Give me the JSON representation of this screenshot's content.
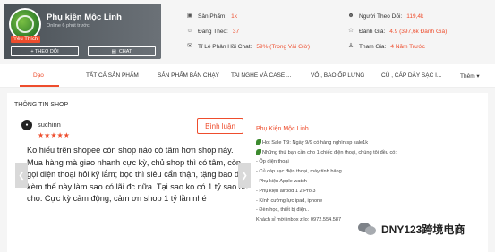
{
  "shop": {
    "name": "Phụ kiện Mộc Linh",
    "online_status": "Online 6 phút trước",
    "badge": "Yêu Thích",
    "follow_label": "+ THEO DÕI",
    "chat_label": "CHAT"
  },
  "stats": {
    "products_label": "Sản Phẩm:",
    "products_value": "1k",
    "following_label": "Đang Theo:",
    "following_value": "37",
    "chat_rate_label": "Tỉ Lệ Phản Hồi Chat:",
    "chat_rate_value": "59% (Trong Vài Giờ)",
    "followers_label": "Người Theo Dõi:",
    "followers_value": "119,4k",
    "rating_label": "Đánh Giá:",
    "rating_value": "4.9 (397,6k Đánh Giá)",
    "joined_label": "Tham Gia:",
    "joined_value": "4 Năm Trước"
  },
  "tabs": [
    {
      "label": "Dạo"
    },
    {
      "label": "TẤT CẢ SẢN PHẨM"
    },
    {
      "label": "SẢN PHẨM BÁN CHẠY"
    },
    {
      "label": "TAI NGHE VÀ CASE ..."
    },
    {
      "label": "VỎ , BAO ỐP LƯNG"
    },
    {
      "label": "CỦ , CÁP DÂY SẠC I..."
    },
    {
      "label": "Thêm ▾"
    }
  ],
  "section_title": "THÔNG TIN SHOP",
  "review": {
    "reviewer": "suchinn",
    "stars": "★★★★★",
    "comment_button": "Bình luận",
    "text": "Ko hiểu trên shopee còn shop nào có tâm hơn shop này. Mua hàng mà giao nhanh cực kỳ, chủ shop thì có tâm, còn gọi điện thoại hỏi kỹ lắm; bọc thì siêu cẩn thận, tặng bao để kèm thế này làm sao có lãi đc nữa. Tại sao ko có 1 tỷ sao để cho. Cực kỳ cảm động, cảm ơn shop 1 tỷ lần nhé"
  },
  "description": {
    "title": "Phụ Kiện Mộc Linh",
    "lines": [
      "Hot Sale T.9: Ngày 9/9 có hàng nghìn sp sale1k",
      "Những thứ bạn cần cho 1 chiếc điện thoại, chúng tôi đều có:",
      "- Ốp điện thoại",
      "- Củ cáp sạc điện thoại, máy tính bảng",
      "- Phụ kiện Apple watch",
      "- Phụ kiện airpod 1 2 Pro 3",
      "- Kính cường lực ipad, iphone",
      "- Đèn học, thiết bị điện..",
      "Khách sỉ mời inbox z.lo: 0972.554.587"
    ]
  },
  "watermark": "DNY123跨境电商",
  "colors": {
    "accent": "#ee4d2d",
    "header_bg": "#5a6168"
  }
}
